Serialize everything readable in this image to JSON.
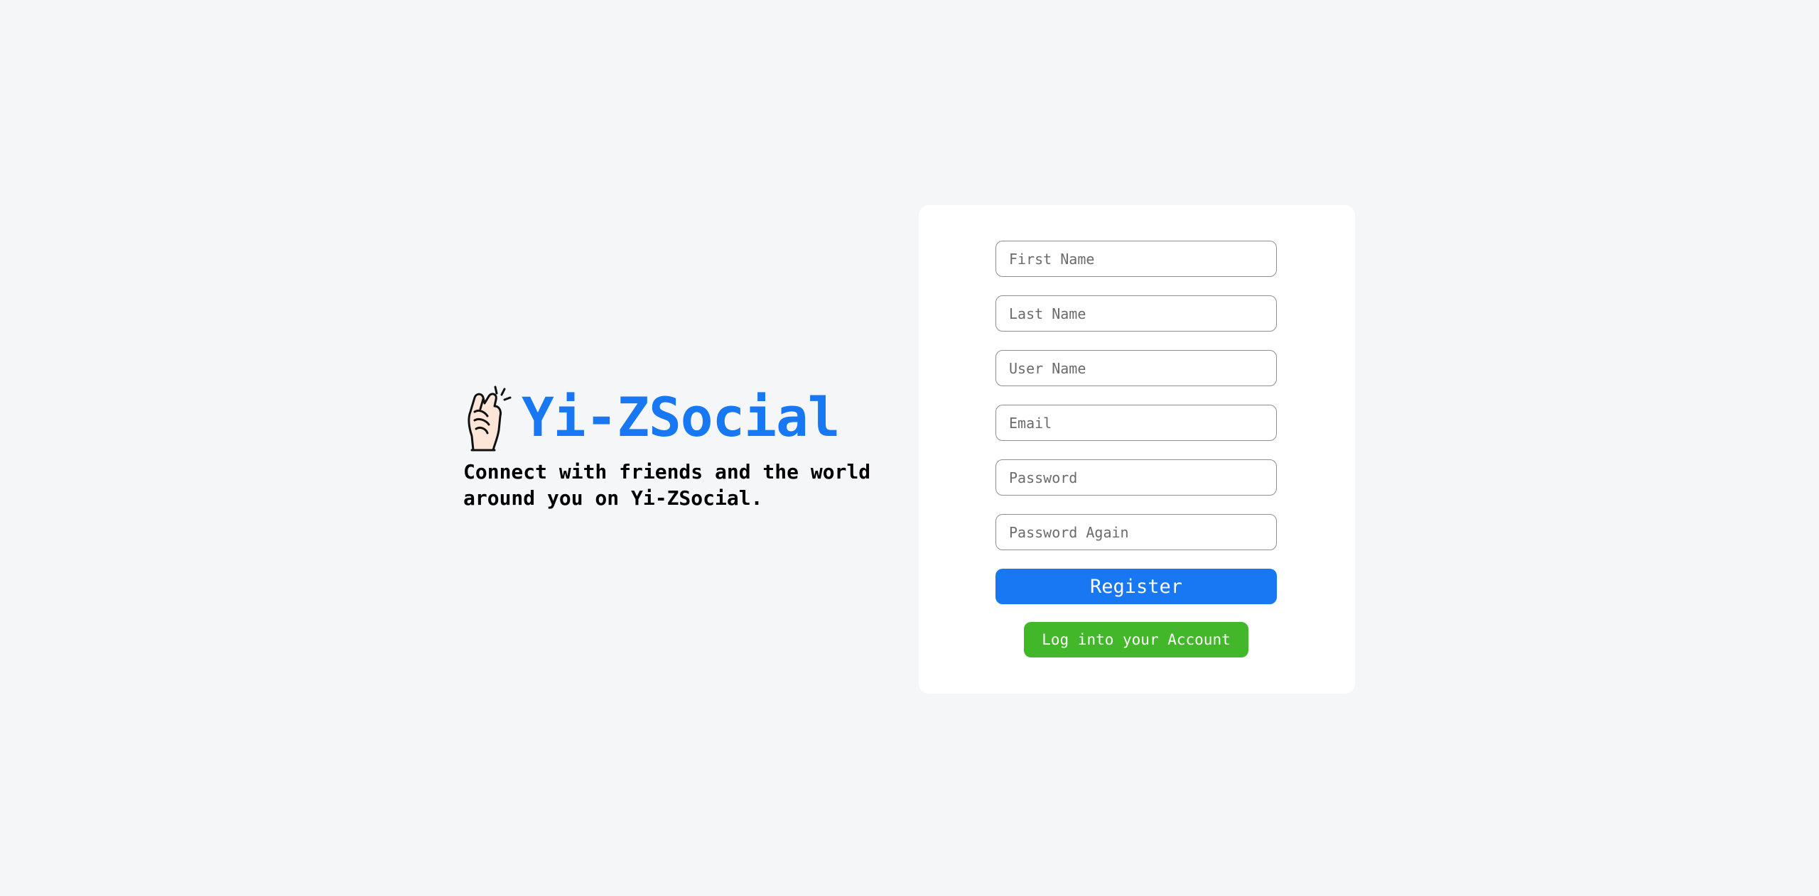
{
  "brand": {
    "title": "Yi-ZSocial",
    "tagline": "Connect with friends and the world\naround you on Yi-ZSocial.",
    "logo_icon": "hand-with-index-finger-and-thumb-crossed-icon",
    "title_color": "#1877f2"
  },
  "form": {
    "first_name_placeholder": "First Name",
    "last_name_placeholder": "Last Name",
    "user_name_placeholder": "User Name",
    "email_placeholder": "Email",
    "password_placeholder": "Password",
    "password_again_placeholder": "Password Again",
    "register_label": "Register",
    "login_label": "Log into your Account",
    "register_color": "#1877f2",
    "login_color": "#42b72a"
  }
}
